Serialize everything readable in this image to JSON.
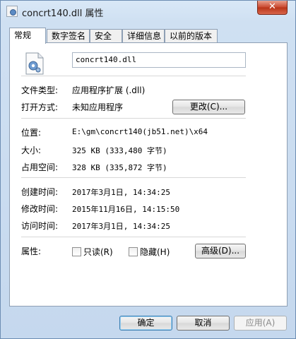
{
  "window": {
    "title": "concrt140.dll 属性",
    "close_label": "✕"
  },
  "tabs": [
    {
      "label": "常规",
      "active": true
    },
    {
      "label": "数字签名",
      "active": false
    },
    {
      "label": "安全",
      "active": false
    },
    {
      "label": "详细信息",
      "active": false
    },
    {
      "label": "以前的版本",
      "active": false
    }
  ],
  "general": {
    "filename": "concrt140.dll",
    "file_type": {
      "label": "文件类型:",
      "value": "应用程序扩展 (.dll)"
    },
    "opens_with": {
      "label": "打开方式:",
      "value": "未知应用程序",
      "button": "更改(C)..."
    },
    "location": {
      "label": "位置:",
      "value": "E:\\gm\\concrt140(jb51.net)\\x64"
    },
    "size": {
      "label": "大小:",
      "value": "325 KB (333,480 字节)"
    },
    "size_on_disk": {
      "label": "占用空间:",
      "value": "328 KB (335,872 字节)"
    },
    "created": {
      "label": "创建时间:",
      "value": "2017年3月1日, 14:34:25"
    },
    "modified": {
      "label": "修改时间:",
      "value": "2015年11月16日, 14:15:50"
    },
    "accessed": {
      "label": "访问时间:",
      "value": "2017年3月1日, 14:34:25"
    },
    "attributes": {
      "label": "属性:",
      "readonly": "只读(R)",
      "hidden": "隐藏(H)",
      "advanced_button": "高级(D)..."
    }
  },
  "footer": {
    "ok": "确定",
    "cancel": "取消",
    "apply": "应用(A)"
  },
  "colors": {
    "frame": "#c5d8ee",
    "close": "#c9462d"
  }
}
